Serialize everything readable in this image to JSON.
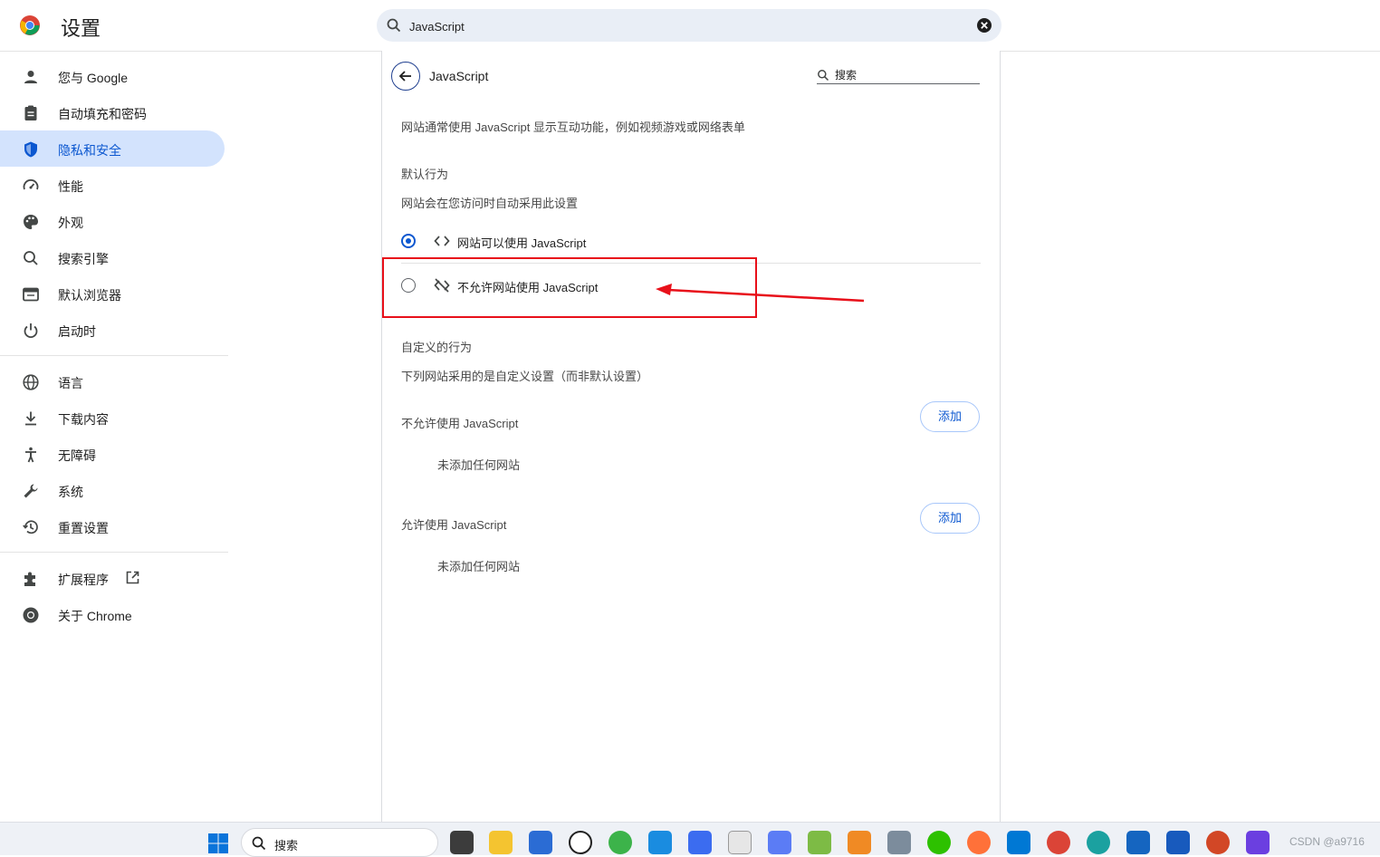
{
  "header": {
    "app_title": "设置",
    "search_value": "JavaScript"
  },
  "sidebar": {
    "items": [
      {
        "label": "您与 Google",
        "icon": "person-icon"
      },
      {
        "label": "自动填充和密码",
        "icon": "clipboard-icon"
      },
      {
        "label": "隐私和安全",
        "icon": "shield-icon",
        "active": true
      },
      {
        "label": "性能",
        "icon": "speedometer-icon"
      },
      {
        "label": "外观",
        "icon": "palette-icon"
      },
      {
        "label": "搜索引擎",
        "icon": "search-icon"
      },
      {
        "label": "默认浏览器",
        "icon": "browser-icon"
      },
      {
        "label": "启动时",
        "icon": "power-icon"
      },
      {
        "label": "语言",
        "icon": "globe-icon"
      },
      {
        "label": "下载内容",
        "icon": "download-icon"
      },
      {
        "label": "无障碍",
        "icon": "accessibility-icon"
      },
      {
        "label": "系统",
        "icon": "wrench-icon"
      },
      {
        "label": "重置设置",
        "icon": "history-icon"
      },
      {
        "label": "扩展程序",
        "icon": "puzzle-icon"
      },
      {
        "label": "关于 Chrome",
        "icon": "chrome-icon"
      }
    ]
  },
  "panel": {
    "title": "JavaScript",
    "search_label": "搜索",
    "description": "网站通常使用 JavaScript 显示互动功能，例如视频游戏或网络表单",
    "default_heading": "默认行为",
    "default_sub": "网站会在您访问时自动采用此设置",
    "option_allow": "网站可以使用 JavaScript",
    "option_block": "不允许网站使用 JavaScript",
    "selected_option": "allow",
    "custom_heading": "自定义的行为",
    "custom_sub": "下列网站采用的是自定义设置（而非默认设置）",
    "block_list_label": "不允许使用 JavaScript",
    "allow_list_label": "允许使用 JavaScript",
    "add_label": "添加",
    "empty_label": "未添加任何网站"
  },
  "taskbar": {
    "search_label": "搜索",
    "watermark": "CSDN @a9716",
    "apps": [
      "task-view-icon",
      "file-explorer-icon",
      "store-icon",
      "dell-icon",
      "browser-green-icon",
      "play-icon",
      "123-pan-icon",
      "notepad-icon",
      "edit-icon",
      "notepad-plus-icon",
      "vm-icon",
      "remote-desktop-icon",
      "wechat-icon",
      "firefox-icon",
      "vscode-icon",
      "chrome-icon",
      "edge-icon",
      "p-app-icon",
      "word-icon",
      "powerpoint-icon",
      "thunder-icon"
    ]
  },
  "colors": {
    "accent": "#0b57d0",
    "active_bg": "#d3e3fd",
    "annotation": "#e8101a"
  }
}
